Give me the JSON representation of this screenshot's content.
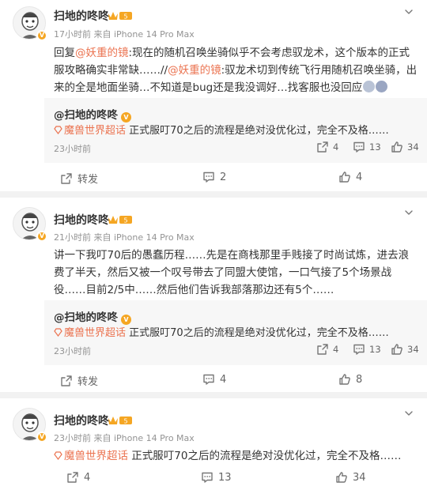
{
  "posts": [
    {
      "author": "扫地的咚咚",
      "meta": "17小时前  来自 iPhone 14 Pro Max",
      "body": {
        "p1": "回复",
        "m1": "@妖重的镜",
        "p2": ":现在的随机召唤坐骑似乎不会考虑驭龙术，这个版本的正式服攻略确实非常缺……//",
        "m2": "@妖重的镜",
        "p3": ":驭龙术切到传统飞行用随机召唤坐骑，出来的全是地面坐骑…不知道是bug还是我没调好…找客服也没回应"
      },
      "quote": {
        "author": "@扫地的咚咚",
        "topic": "魔兽世界超话",
        "text": " 正式服叮70之后的流程是绝对没优化过，完全不及格……",
        "time": "23小时前",
        "share": "4",
        "comment": "13",
        "like": "34"
      },
      "actions": {
        "share": "转发",
        "comment": "2",
        "like": "4"
      }
    },
    {
      "author": "扫地的咚咚",
      "meta": "21小时前  来自 iPhone 14 Pro Max",
      "body": "讲一下我叮70后的愚蠢历程……先是在商栈那里手贱接了时尚试炼，进去浪费了半天，然后又被一个叹号带去了同盟大使馆，一口气接了5个场景战役……目前2/5中……然后他们告诉我部落那边还有5个……",
      "quote": {
        "author": "@扫地的咚咚",
        "topic": "魔兽世界超话",
        "text": " 正式服叮70之后的流程是绝对没优化过，完全不及格……",
        "time": "23小时前",
        "share": "4",
        "comment": "13",
        "like": "34"
      },
      "actions": {
        "share": "转发",
        "comment": "4",
        "like": "8"
      }
    },
    {
      "author": "扫地的咚咚",
      "meta": "23小时前  来自 iPhone 14 Pro Max",
      "topic": "魔兽世界超话",
      "body": " 正式服叮70之后的流程是绝对没优化过，完全不及格……",
      "actions": {
        "share": "4",
        "comment": "13",
        "like": "34"
      }
    }
  ],
  "colors": {
    "link": "#eb7350",
    "badge": "#f5a623",
    "meta": "#939393",
    "quote_bg": "#f7f7f7"
  }
}
